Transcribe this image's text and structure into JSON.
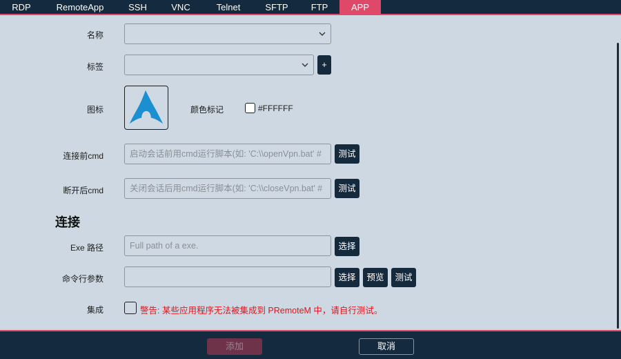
{
  "tabs": [
    {
      "label": "RDP"
    },
    {
      "label": "RemoteApp"
    },
    {
      "label": "SSH"
    },
    {
      "label": "VNC"
    },
    {
      "label": "Telnet"
    },
    {
      "label": "SFTP"
    },
    {
      "label": "FTP"
    },
    {
      "label": "APP",
      "active": true
    }
  ],
  "form": {
    "name_label": "名称",
    "name_value": "",
    "tags_label": "标签",
    "tags_value": "",
    "add_tag_label": "+",
    "icon_label": "图标",
    "color_label": "颜色标记",
    "color_value": "#FFFFFF",
    "pre_cmd_label": "连接前cmd",
    "pre_cmd_placeholder": "启动会话前用cmd运行脚本(如: 'C:\\\\openVpn.bat' #",
    "post_cmd_label": "断开后cmd",
    "post_cmd_placeholder": "关闭会话后用cmd运行脚本(如: 'C:\\\\closeVpn.bat' #",
    "test_label": "测试"
  },
  "connection": {
    "section_title": "连接",
    "exe_label": "Exe 路径",
    "exe_placeholder": "Full path of a exe.",
    "select_label": "选择",
    "args_label": "命令行参数",
    "args_value": "",
    "preview_label": "预览",
    "test_label": "测试",
    "integrate_label": "集成",
    "warning": "警告: 某些应用程序无法被集成到 PRemoteM 中，请自行测试。"
  },
  "footer": {
    "add_label": "添加",
    "cancel_label": "取消"
  },
  "colors": {
    "accent": "#e0486a",
    "dark": "#142a3e",
    "background": "#cdd8e2",
    "warning": "#e3141b",
    "app_icon": "#1b8fd0"
  },
  "icons": {
    "app_icon": "arch-linux-logo-icon",
    "dropdown": "chevron-down-icon"
  }
}
